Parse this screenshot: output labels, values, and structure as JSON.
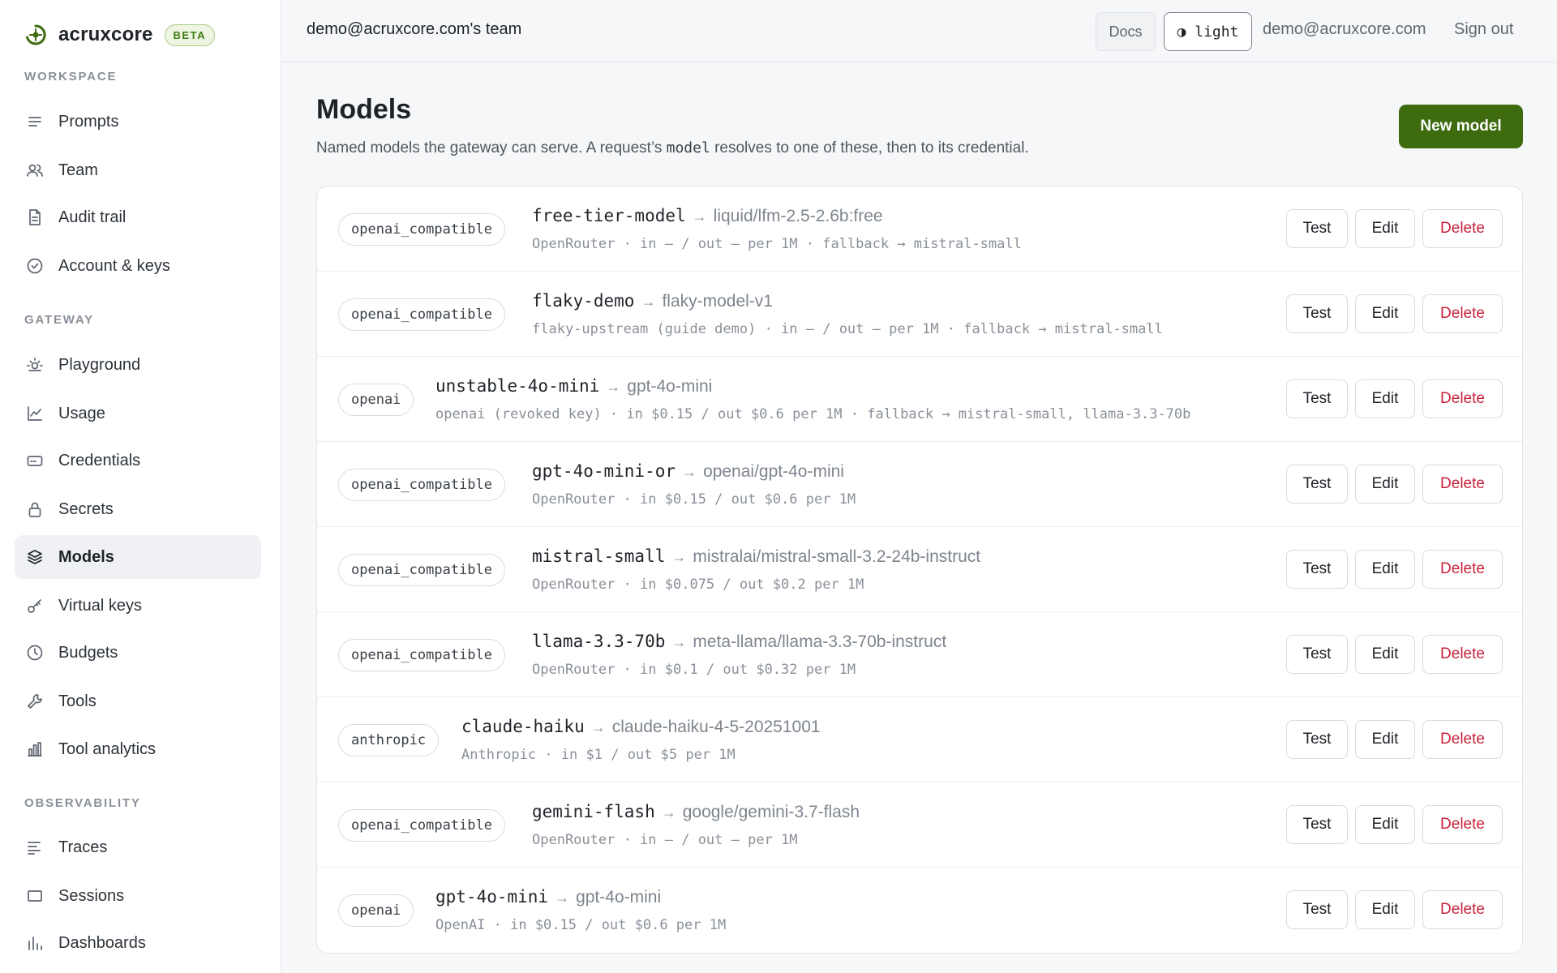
{
  "brand": {
    "name": "acruxcore",
    "badge": "BETA"
  },
  "sidebar": {
    "sections": [
      {
        "title": "WORKSPACE",
        "items": [
          {
            "label": "Prompts",
            "icon": "lines-icon"
          },
          {
            "label": "Team",
            "icon": "users-icon"
          },
          {
            "label": "Audit trail",
            "icon": "document-icon"
          },
          {
            "label": "Account & keys",
            "icon": "check-circle-icon"
          }
        ]
      },
      {
        "title": "GATEWAY",
        "items": [
          {
            "label": "Playground",
            "icon": "sun-icon"
          },
          {
            "label": "Usage",
            "icon": "line-chart-icon"
          },
          {
            "label": "Credentials",
            "icon": "card-icon"
          },
          {
            "label": "Secrets",
            "icon": "lock-icon"
          },
          {
            "label": "Models",
            "icon": "layers-icon",
            "active": true
          },
          {
            "label": "Virtual keys",
            "icon": "key-icon"
          },
          {
            "label": "Budgets",
            "icon": "clock-icon"
          },
          {
            "label": "Tools",
            "icon": "wrench-icon"
          },
          {
            "label": "Tool analytics",
            "icon": "bar-chart-icon"
          }
        ]
      },
      {
        "title": "OBSERVABILITY",
        "items": [
          {
            "label": "Traces",
            "icon": "traces-icon"
          },
          {
            "label": "Sessions",
            "icon": "rectangle-icon"
          },
          {
            "label": "Dashboards",
            "icon": "bars-icon"
          }
        ]
      }
    ]
  },
  "header": {
    "team": "demo@acruxcore.com's team",
    "docs": "Docs",
    "theme": "◑ light",
    "email": "demo@acruxcore.com",
    "signout": "Sign out"
  },
  "page": {
    "title": "Models",
    "desc_pre": "Named models the gateway can serve. A request’s ",
    "desc_code": "model",
    "desc_post": " resolves to one of these, then to its credential.",
    "new_button": "New model"
  },
  "actions": {
    "test": "Test",
    "edit": "Edit",
    "delete": "Delete"
  },
  "arrow": "→",
  "models": [
    {
      "provider": "openai_compatible",
      "name": "free-tier-model",
      "target": "liquid/lfm-2.5-2.6b:free",
      "meta": "OpenRouter · in — / out — per 1M · fallback → mistral-small"
    },
    {
      "provider": "openai_compatible",
      "name": "flaky-demo",
      "target": "flaky-model-v1",
      "meta": "flaky-upstream (guide demo) · in — / out — per 1M · fallback → mistral-small"
    },
    {
      "provider": "openai",
      "name": "unstable-4o-mini",
      "target": "gpt-4o-mini",
      "meta": "openai (revoked key) · in $0.15 / out $0.6 per 1M · fallback → mistral-small, llama-3.3-70b"
    },
    {
      "provider": "openai_compatible",
      "name": "gpt-4o-mini-or",
      "target": "openai/gpt-4o-mini",
      "meta": "OpenRouter · in $0.15 / out $0.6 per 1M"
    },
    {
      "provider": "openai_compatible",
      "name": "mistral-small",
      "target": "mistralai/mistral-small-3.2-24b-instruct",
      "meta": "OpenRouter · in $0.075 / out $0.2 per 1M"
    },
    {
      "provider": "openai_compatible",
      "name": "llama-3.3-70b",
      "target": "meta-llama/llama-3.3-70b-instruct",
      "meta": "OpenRouter · in $0.1 / out $0.32 per 1M"
    },
    {
      "provider": "anthropic",
      "name": "claude-haiku",
      "target": "claude-haiku-4-5-20251001",
      "meta": "Anthropic · in $1 / out $5 per 1M"
    },
    {
      "provider": "openai_compatible",
      "name": "gemini-flash",
      "target": "google/gemini-3.7-flash",
      "meta": "OpenRouter · in — / out — per 1M"
    },
    {
      "provider": "openai",
      "name": "gpt-4o-mini",
      "target": "gpt-4o-mini",
      "meta": "OpenAI · in $0.15 / out $0.6 per 1M"
    }
  ]
}
